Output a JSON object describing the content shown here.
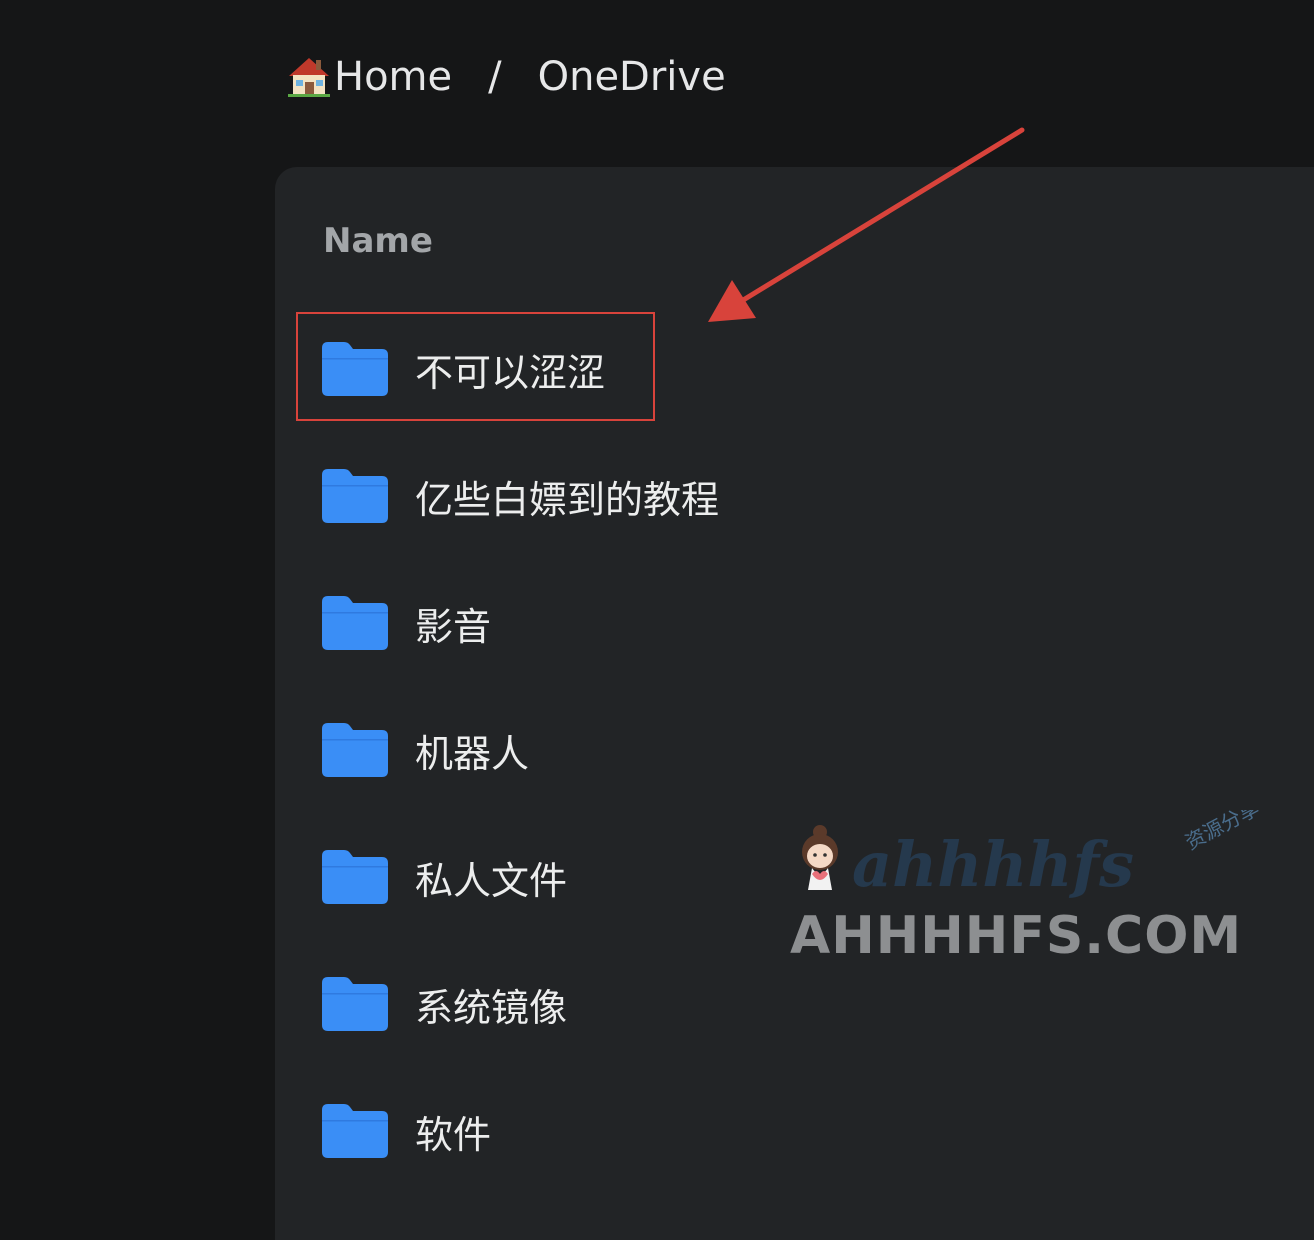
{
  "breadcrumb": {
    "home_label": "Home",
    "separator": "/",
    "current": "OneDrive"
  },
  "list": {
    "column_name": "Name",
    "items": [
      {
        "label": "不可以涩涩",
        "icon": "folder-icon"
      },
      {
        "label": "亿些白嫖到的教程",
        "icon": "folder-icon"
      },
      {
        "label": "影音",
        "icon": "folder-icon"
      },
      {
        "label": "机器人",
        "icon": "folder-icon"
      },
      {
        "label": "私人文件",
        "icon": "folder-icon"
      },
      {
        "label": "系统镜像",
        "icon": "folder-icon"
      },
      {
        "label": "软件",
        "icon": "folder-icon"
      }
    ]
  },
  "annotation": {
    "color": "#d8433b"
  },
  "watermark": {
    "logo_text": "ahhhhfs",
    "logo_tag": "资源分享",
    "site": "AHHHHFS.COM"
  },
  "colors": {
    "background": "#151617",
    "panel": "#222426",
    "folder": "#3a8ef6",
    "text": "#eceded",
    "header_text": "#a3a6a9"
  }
}
